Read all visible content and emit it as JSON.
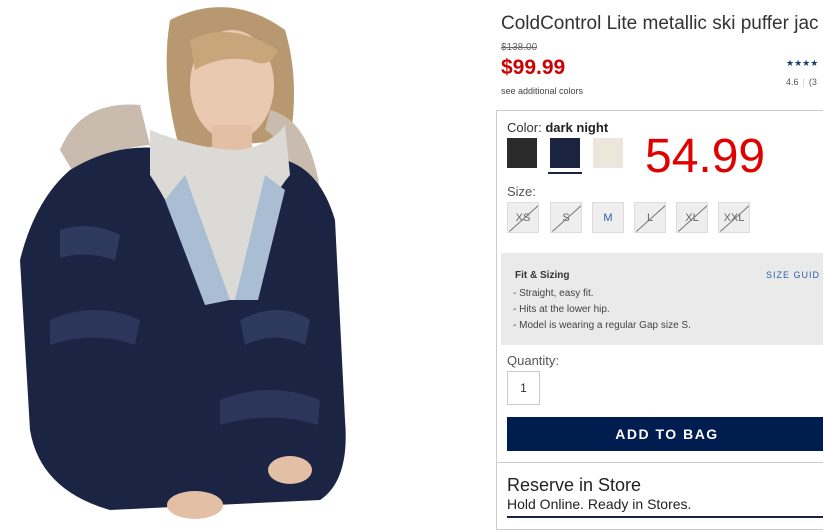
{
  "product": {
    "title": "ColdControl Lite metallic ski puffer jac",
    "original_price": "$138.00",
    "sale_price": "$99.99",
    "see_colors": "see additional colors",
    "stars": "★★★★",
    "rating": "4.6",
    "review_count": "(3"
  },
  "overlay_price": "54.99",
  "color": {
    "label": "Color:",
    "selected": "dark night",
    "swatches": [
      "#2b2b2b",
      "#1a2340",
      "#ece6dc"
    ]
  },
  "size": {
    "label": "Size:",
    "options": [
      {
        "label": "XS",
        "available": false
      },
      {
        "label": "S",
        "available": false
      },
      {
        "label": "M",
        "available": true
      },
      {
        "label": "L",
        "available": false
      },
      {
        "label": "XL",
        "available": false
      },
      {
        "label": "XXL",
        "available": false
      }
    ]
  },
  "fit": {
    "title": "Fit & Sizing",
    "guide_link": "SIZE GUID",
    "items": [
      "- Straight, easy fit.",
      "- Hits at the lower hip.",
      "- Model is wearing a regular Gap size S."
    ]
  },
  "quantity": {
    "label": "Quantity:",
    "value": "1"
  },
  "add_to_bag": "ADD TO BAG",
  "reserve": {
    "title": "Reserve in Store",
    "subtitle": "Hold Online. Ready in Stores."
  },
  "colors": {
    "sale_red": "#cc0000",
    "brand_navy": "#001d4f",
    "link_blue": "#2a62a8"
  }
}
